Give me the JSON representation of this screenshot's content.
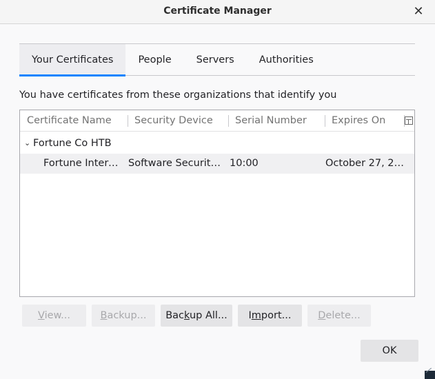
{
  "window": {
    "title": "Certificate Manager"
  },
  "tabs": [
    {
      "label": "Your Certificates",
      "selected": true
    },
    {
      "label": "People",
      "selected": false
    },
    {
      "label": "Servers",
      "selected": false
    },
    {
      "label": "Authorities",
      "selected": false
    }
  ],
  "intro_text": "You have certificates from these organizations that identify you",
  "table": {
    "columns": [
      "Certificate Name",
      "Security Device",
      "Serial Number",
      "Expires On"
    ],
    "groups": [
      {
        "name": "Fortune Co HTB",
        "expanded": true,
        "rows": [
          {
            "certificate_name": "Fortune Interm...",
            "security_device": "Software Security ...",
            "serial_number": "10:00",
            "expires_on": "October 27, 20..."
          }
        ]
      }
    ]
  },
  "buttons": {
    "view": {
      "label": "View...",
      "accesskey": "V",
      "enabled": false
    },
    "backup": {
      "label": "Backup...",
      "accesskey": "B",
      "enabled": false
    },
    "backup_all": {
      "label": "Backup All...",
      "accesskey": "k",
      "enabled": true
    },
    "import": {
      "label": "Import...",
      "accesskey": "m",
      "enabled": true
    },
    "delete": {
      "label": "Delete...",
      "accesskey": "D",
      "enabled": false
    },
    "ok": {
      "label": "OK"
    }
  },
  "colors": {
    "accent": "#0a84ff",
    "selected_row": "#f0f0f2"
  }
}
